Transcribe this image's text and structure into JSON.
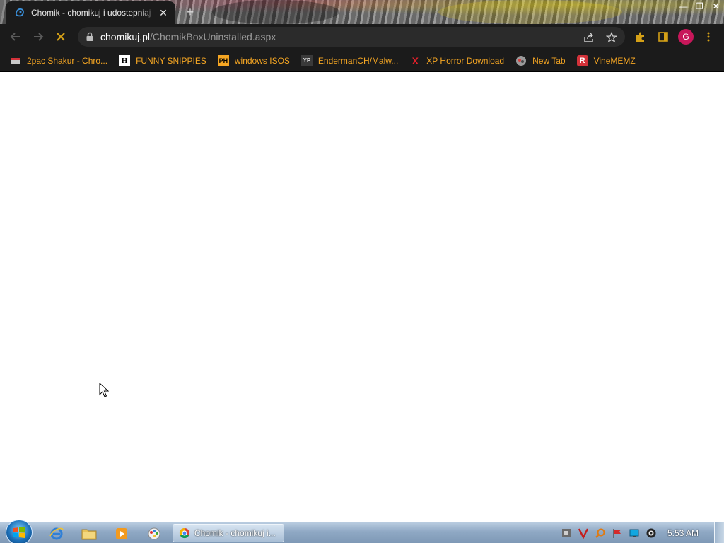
{
  "tab": {
    "title": "Chomik - chomikuj i udostepniaj",
    "close_symbol": "✕",
    "favicon": "chomikuj-favicon"
  },
  "new_tab_symbol": "+",
  "window_controls": {
    "minimize": "—",
    "restore": "❐",
    "close": "✕"
  },
  "toolbar": {
    "url_domain": "chomikuj.pl",
    "url_path": "/ChomikBoxUninstalled.aspx",
    "avatar_letter": "G",
    "avatar_color": "#c8175a"
  },
  "bookmarks": [
    {
      "label": "2pac Shakur - Chro...",
      "icon": "2pac-favicon"
    },
    {
      "label": "FUNNY SNIPPIES",
      "icon": "h-favicon",
      "icon_text": "H"
    },
    {
      "label": "windows ISOS",
      "icon": "ph-favicon",
      "icon_text": "PH"
    },
    {
      "label": "EndermanCH/Malw...",
      "icon": "yp-favicon",
      "icon_text": "YP"
    },
    {
      "label": "XP Horror Download",
      "icon": "x-favicon",
      "icon_text": "X"
    },
    {
      "label": "New Tab",
      "icon": "newtab-favicon"
    },
    {
      "label": "VineMEMZ",
      "icon": "r-favicon",
      "icon_text": "R"
    }
  ],
  "taskbar": {
    "active_window_label": "Chomik - chomikuj i...",
    "clock": "5:53 AM",
    "pinned": [
      "internet-explorer-icon",
      "explorer-folder-icon",
      "media-player-icon",
      "paint-icon"
    ]
  },
  "colors": {
    "chrome_bg": "#1b1b1b",
    "bookmark_text": "#f5a623",
    "omnibox_bg": "#2b2b2b"
  }
}
